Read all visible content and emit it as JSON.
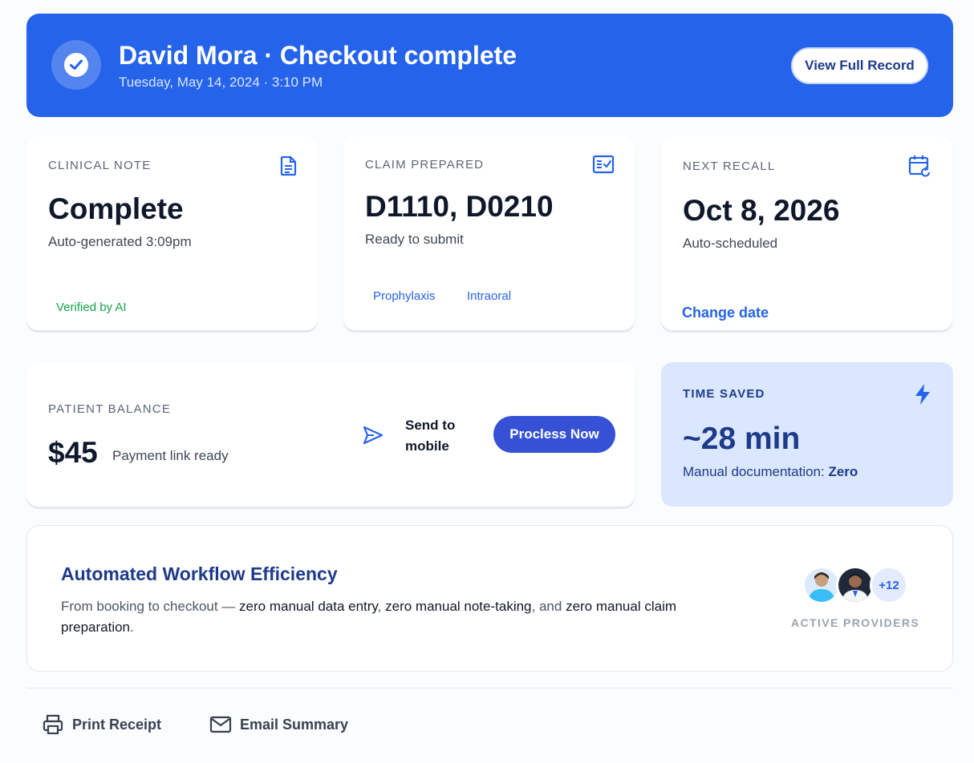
{
  "header": {
    "title": "David Mora · Checkout complete",
    "datetime": "Tuesday, May 14, 2024 · 3:10 PM",
    "view_button": "View Full Record",
    "icon": "check-circle-icon"
  },
  "cards": {
    "clinical_note": {
      "label": "CLINICAL NOTE",
      "value": "Complete",
      "sub": "Auto-generated 3:09pm",
      "badge": "Verified by AI",
      "icon": "document-icon"
    },
    "claim": {
      "label": "CLAIM PREPARED",
      "value": "D1110, D0210",
      "sub": "Ready to submit",
      "tags": [
        "Prophylaxis",
        "Intraoral"
      ],
      "icon": "checklist-icon"
    },
    "recall": {
      "label": "NEXT RECALL",
      "value": "Oct 8, 2026",
      "sub": "Auto-scheduled",
      "link": "Change date",
      "icon": "calendar-refresh-icon"
    },
    "balance": {
      "label": "PATIENT BALANCE",
      "amount": "$45",
      "note": "Payment link ready",
      "send_label": "Send to mobile",
      "process_button": "Procless Now",
      "icon": "send-icon"
    },
    "time_saved": {
      "label": "TIME SAVED",
      "value": "~28 min",
      "sub_prefix": "Manual documentation:",
      "sub_value": "Zero",
      "icon": "lightning-icon"
    }
  },
  "workflow": {
    "title": "Automated Workflow Efficiency",
    "desc_1": "From booking to checkout — ",
    "desc_2": "zero manual data entry",
    "desc_3": ", ",
    "desc_4": "zero manual note-taking",
    "desc_5": ", and ",
    "desc_6": "zero manual claim preparation",
    "desc_7": ".",
    "more_count": "+12",
    "providers_label": "ACTIVE PROVIDERS"
  },
  "footer": {
    "print_label": "Print Receipt",
    "email_label": "Email Summary"
  },
  "colors": {
    "brand": "#2563eb",
    "success": "#16a34a",
    "navy": "#1e3a8a",
    "highlight_bg": "#dbe7fe"
  }
}
